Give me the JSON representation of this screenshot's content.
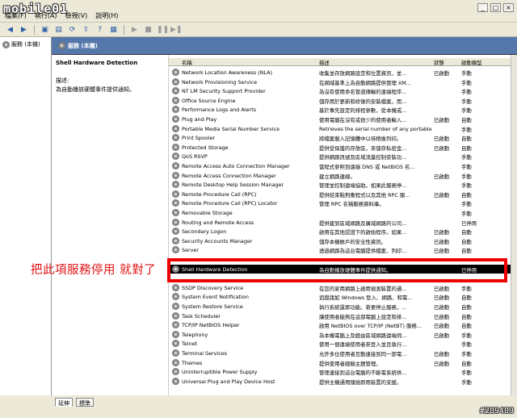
{
  "logo": "mobile01",
  "watermark": "#209409",
  "menu": [
    "檔案(F)",
    "執行(A)",
    "檢視(V)",
    "說明(H)"
  ],
  "tree": {
    "root": "服務 (本機)"
  },
  "header": {
    "title": "服務 (本機)"
  },
  "detail": {
    "service_name": "Shell Hardware Detection",
    "description_label": "描述:",
    "description": "為自動播放硬體事件提供通知。"
  },
  "columns": {
    "name": "名稱",
    "desc": "描述",
    "status": "狀態",
    "startup": "啟動類型"
  },
  "rows": [
    {
      "name": "Network Location Awareness (NLA)",
      "desc": "收集並存放網路設定和位置資訊，並...",
      "status": "已啟動",
      "startup": "手動"
    },
    {
      "name": "Network Provisioning Service",
      "desc": "在網域基準上為自動網路提供管理 XM...",
      "status": "",
      "startup": "手動"
    },
    {
      "name": "NT LM Security Support Provider",
      "desc": "為沒有使用命名管道傳輸的遠端程序...",
      "status": "",
      "startup": "手動"
    },
    {
      "name": "Office Source Engine",
      "desc": "儲存用於更新和修復的安裝檔案，而...",
      "status": "",
      "startup": "手動"
    },
    {
      "name": "Performance Logs and Alerts",
      "desc": "基於事先設定的排程參數，從本機或...",
      "status": "",
      "startup": "手動"
    },
    {
      "name": "Plug and Play",
      "desc": "使用電腦在沒有或很少的使用者輸入...",
      "status": "已啟動",
      "startup": "自動"
    },
    {
      "name": "Portable Media Serial Number Service",
      "desc": "Retrieves the serial number of any portable ...",
      "status": "",
      "startup": "手動"
    },
    {
      "name": "Print Spooler",
      "desc": "將檔案載入記憶體中以待稍後列印。",
      "status": "已啟動",
      "startup": "自動"
    },
    {
      "name": "Protected Storage",
      "desc": "提供受保護的存放區，來儲存私密金...",
      "status": "已啟動",
      "startup": "自動"
    },
    {
      "name": "QoS RSVP",
      "desc": "提供網路訊號及區域流量控制安裝功...",
      "status": "",
      "startup": "手動"
    },
    {
      "name": "Remote Access Auto Connection Manager",
      "desc": "當程式參照到遠端 DNS 或 NetBIOS 名...",
      "status": "",
      "startup": "手動"
    },
    {
      "name": "Remote Access Connection Manager",
      "desc": "建立網路連線。",
      "status": "已啟動",
      "startup": "手動"
    },
    {
      "name": "Remote Desktop Help Session Manager",
      "desc": "管理並控制遠端協助。如果此服務停...",
      "status": "",
      "startup": "手動"
    },
    {
      "name": "Remote Procedure Call (RPC)",
      "desc": "提供結束點對應程式以及其他 RPC 服...",
      "status": "已啟動",
      "startup": "自動"
    },
    {
      "name": "Remote Procedure Call (RPC) Locator",
      "desc": "管理 RPC 名稱服務資料庫。",
      "status": "",
      "startup": "手動"
    },
    {
      "name": "Removable Storage",
      "desc": "",
      "status": "",
      "startup": "手動"
    },
    {
      "name": "Routing and Remote Access",
      "desc": "提供建到區域網路及廣域網路的公司...",
      "status": "",
      "startup": "已停用"
    },
    {
      "name": "Secondary Logon",
      "desc": "啟用在其他認證下的啟始程序。如果...",
      "status": "已啟動",
      "startup": "自動"
    },
    {
      "name": "Security Accounts Manager",
      "desc": "儲存本機帳戶的安全性資訊。",
      "status": "已啟動",
      "startup": "自動"
    },
    {
      "name": "Server",
      "desc": "透過網路為這台電腦提供檔案、列印...",
      "status": "已啟動",
      "startup": "自動"
    },
    {
      "name": "",
      "desc": "",
      "status": "",
      "startup": ""
    },
    {
      "name": "Shell Hardware Detection",
      "desc": "為自動播放硬體事件提供通知。",
      "status": "",
      "startup": "已停用",
      "selected": true
    },
    {
      "name": "",
      "desc": "",
      "status": "",
      "startup": ""
    },
    {
      "name": "SSDP Discovery Service",
      "desc": "在您的家用網路上啟用偵測裝置的通...",
      "status": "已啟動",
      "startup": "手動"
    },
    {
      "name": "System Event Notification",
      "desc": "追蹤諸如 Windows 登入、網路、和電...",
      "status": "已啟動",
      "startup": "自動"
    },
    {
      "name": "System Restore Service",
      "desc": "執行系統還原功能。若要停止服務，...",
      "status": "已啟動",
      "startup": "自動"
    },
    {
      "name": "Task Scheduler",
      "desc": "讓使用者能夠在這部電腦上設定和排...",
      "status": "已啟動",
      "startup": "自動"
    },
    {
      "name": "TCP/IP NetBIOS Helper",
      "desc": "啟用 NetBIOS over TCP/IP (NetBT) 服務...",
      "status": "已啟動",
      "startup": "自動"
    },
    {
      "name": "Telephony",
      "desc": "為本機電腦上及經由區域網路遠端伺...",
      "status": "已啟動",
      "startup": "手動"
    },
    {
      "name": "Telnet",
      "desc": "使用一個遠端使用者來登入並且執行...",
      "status": "",
      "startup": "手動"
    },
    {
      "name": "Terminal Services",
      "desc": "允許多位使用者互動連接到同一部電...",
      "status": "已啟動",
      "startup": "手動"
    },
    {
      "name": "Themes",
      "desc": "提供使用者經驗主題管理。",
      "status": "已啟動",
      "startup": "自動"
    },
    {
      "name": "Uninterruptible Power Supply",
      "desc": "管理連接到這台電腦的不斷電系統供...",
      "status": "",
      "startup": "手動"
    },
    {
      "name": "Universal Plug and Play Device Host",
      "desc": "提供主機通用隨插即用裝置的支援。",
      "status": "",
      "startup": "手動"
    },
    {
      "name": "",
      "desc": "",
      "status": "",
      "startup": ""
    }
  ],
  "tabs": [
    "延伸",
    "標準"
  ],
  "annotation": "把此項服務停用 就對了"
}
